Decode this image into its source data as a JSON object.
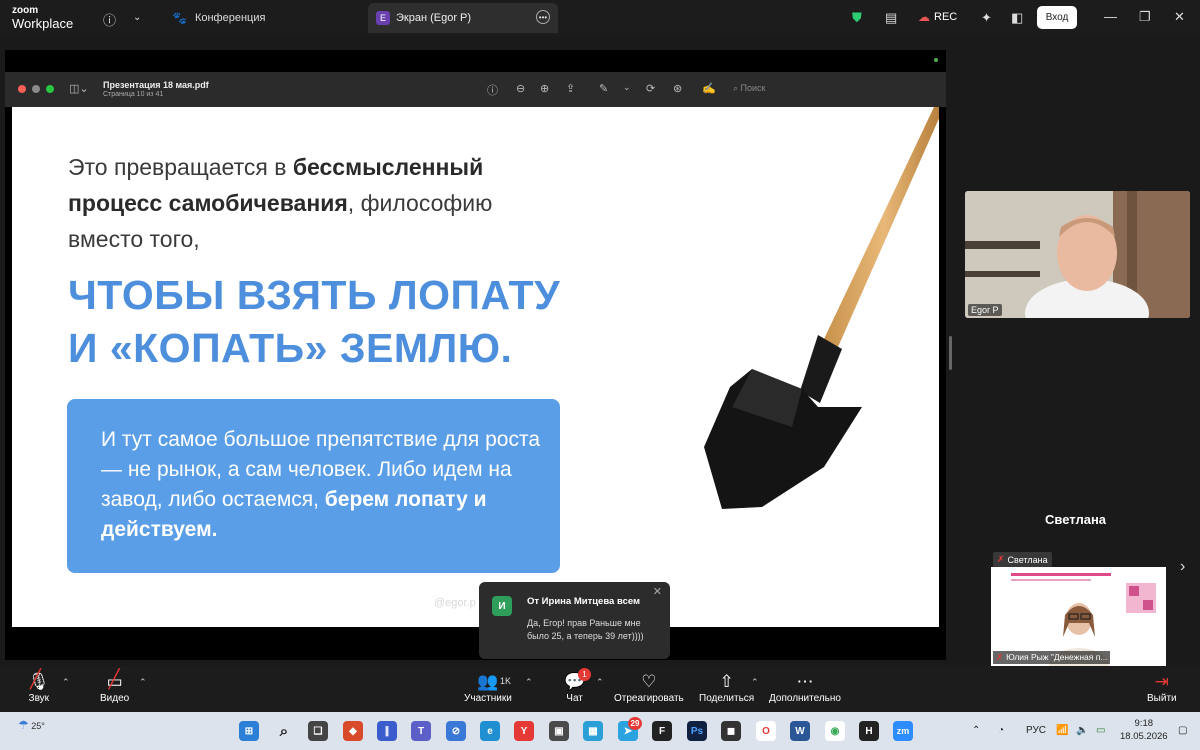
{
  "topbar": {
    "logo_line1": "zoom",
    "logo_line2": "Workplace",
    "tab_conference": "Конференция",
    "tab_screen": "Экран (Egor P)",
    "rec_label": "REC",
    "login_label": "Вход"
  },
  "pdf": {
    "title": "Презентация 18 мая.pdf",
    "page_info": "Страница 10 из 41",
    "search_placeholder": "Поиск"
  },
  "slide": {
    "intro_1": "Это превращается в ",
    "intro_bold": "бессмысленный процесс самобичевания",
    "intro_2": ", философию вместо того,",
    "headline_1": "ЧТОБЫ ВЗЯТЬ ЛОПАТУ",
    "headline_2": "И «КОПАТЬ» ЗЕМЛЮ.",
    "box_text": "И тут самое большое препятствие для роста — не рынок, а сам человек. Либо идем на завод, либо остаемся, ",
    "box_bold": "берем лопату и действуем.",
    "footer": "@egor.p"
  },
  "notification": {
    "avatar_letter": "И",
    "from": "От Ирина Митцева всем",
    "message": "Да, Егор! прав Раньше мне было 25, а теперь 39 лет))))"
  },
  "participants_panel": {
    "egor_label": "Egor P",
    "svetlana_name": "Светлана",
    "svetlana_label": "Светлана",
    "yulia_label": "Юлия Рыж \"Денежная п..."
  },
  "toolbar": {
    "audio": "Звук",
    "video": "Видео",
    "participants": "Участники",
    "participants_count": "1K",
    "chat": "Чат",
    "chat_badge": "1",
    "react": "Отреагировать",
    "share": "Поделиться",
    "more": "Дополнительно",
    "leave": "Выйти"
  },
  "taskbar": {
    "weather_temp": "25°",
    "lang": "РУС",
    "time": "9:18",
    "date": "18.05.2026",
    "telegram_badge": "29"
  },
  "colors": {
    "slide_blue": "#4d8fdc",
    "box_blue": "#5b9ee8",
    "chat_avatar": "#2e9e5a",
    "badge_red": "#e53935"
  }
}
